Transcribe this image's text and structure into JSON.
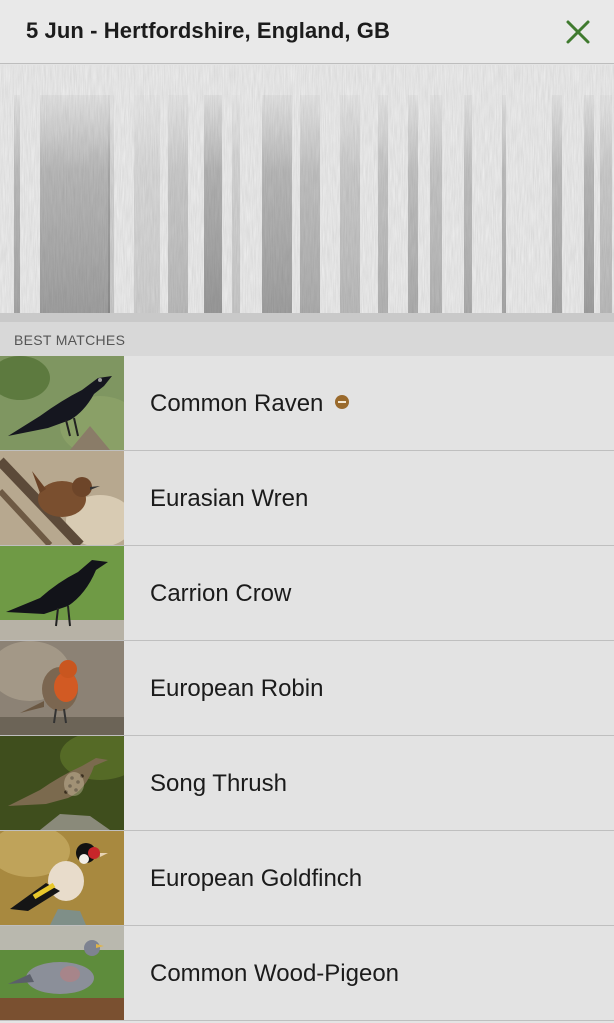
{
  "header": {
    "title": "5 Jun - Hertfordshire, England, GB",
    "close_icon": "close-icon",
    "accent": "#3f7a2e"
  },
  "section": {
    "label": "BEST MATCHES"
  },
  "matches": [
    {
      "name": "Common Raven",
      "badge": true,
      "image": "common-raven-photo"
    },
    {
      "name": "Eurasian Wren",
      "badge": false,
      "image": "eurasian-wren-photo"
    },
    {
      "name": "Carrion Crow",
      "badge": false,
      "image": "carrion-crow-photo"
    },
    {
      "name": "European Robin",
      "badge": false,
      "image": "european-robin-photo"
    },
    {
      "name": "Song Thrush",
      "badge": false,
      "image": "song-thrush-photo"
    },
    {
      "name": "European Goldfinch",
      "badge": false,
      "image": "european-goldfinch-photo"
    },
    {
      "name": "Common Wood-Pigeon",
      "badge": false,
      "image": "common-wood-pigeon-photo"
    }
  ]
}
